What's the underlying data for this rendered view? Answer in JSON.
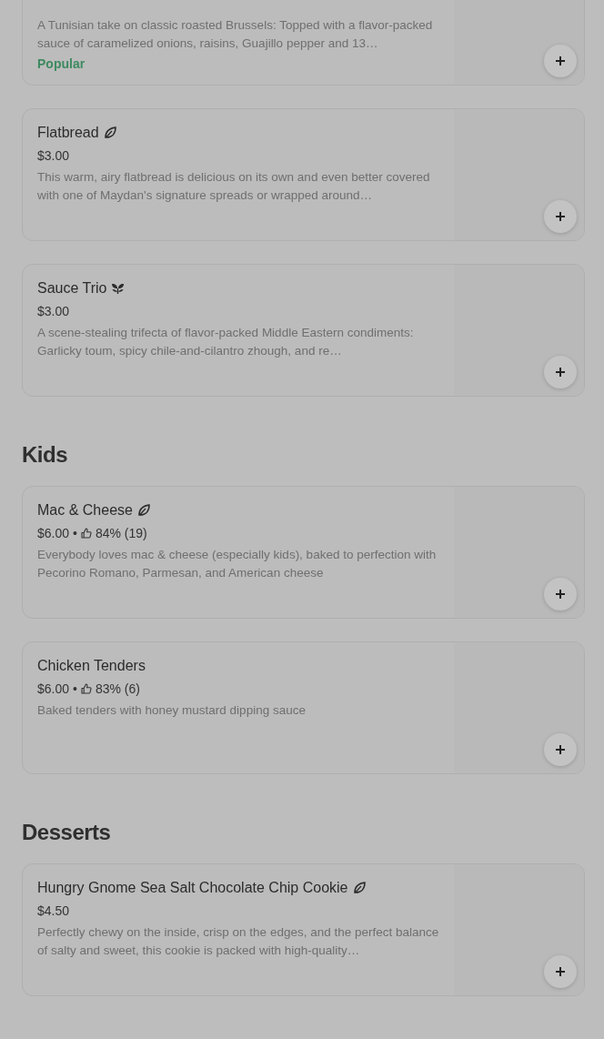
{
  "sections": [
    {
      "items": [
        {
          "description": "A Tunisian take on classic roasted Brussels: Topped with a flavor-packed sauce of caramelized onions, raisins, Guajillo pepper and 13…",
          "badge": "Popular"
        },
        {
          "name": "Flatbread",
          "kind": "leaf",
          "price": "$3.00",
          "description": "This warm, airy flatbread is delicious on its own and even better covered with one of Maydan's signature spreads or wrapped around…"
        },
        {
          "name": "Sauce Trio",
          "kind": "sprout",
          "price": "$3.00",
          "description": "A scene-stealing trifecta of flavor-packed Middle Eastern condiments: Garlicky toum, spicy chile-and-cilantro zhough, and re…"
        }
      ]
    },
    {
      "heading": "Kids",
      "items": [
        {
          "name": "Mac & Cheese",
          "kind": "leaf",
          "price": "$6.00",
          "separator": "•",
          "rating": "84% (19)",
          "description": "Everybody loves mac & cheese (especially kids), baked to perfection with Pecorino Romano, Parmesan, and American cheese"
        },
        {
          "name": "Chicken Tenders",
          "price": "$6.00",
          "separator": "•",
          "rating": "83% (6)",
          "description": "Baked tenders with honey mustard dipping sauce"
        }
      ]
    },
    {
      "heading": "Desserts",
      "items": [
        {
          "name": "Hungry Gnome Sea Salt Chocolate Chip Cookie",
          "kind": "leaf",
          "price": "$4.50",
          "description": "Perfectly chewy on the inside, crisp on the edges, and the perfect balance of salty and sweet, this cookie is packed with high-quality…"
        }
      ]
    }
  ]
}
